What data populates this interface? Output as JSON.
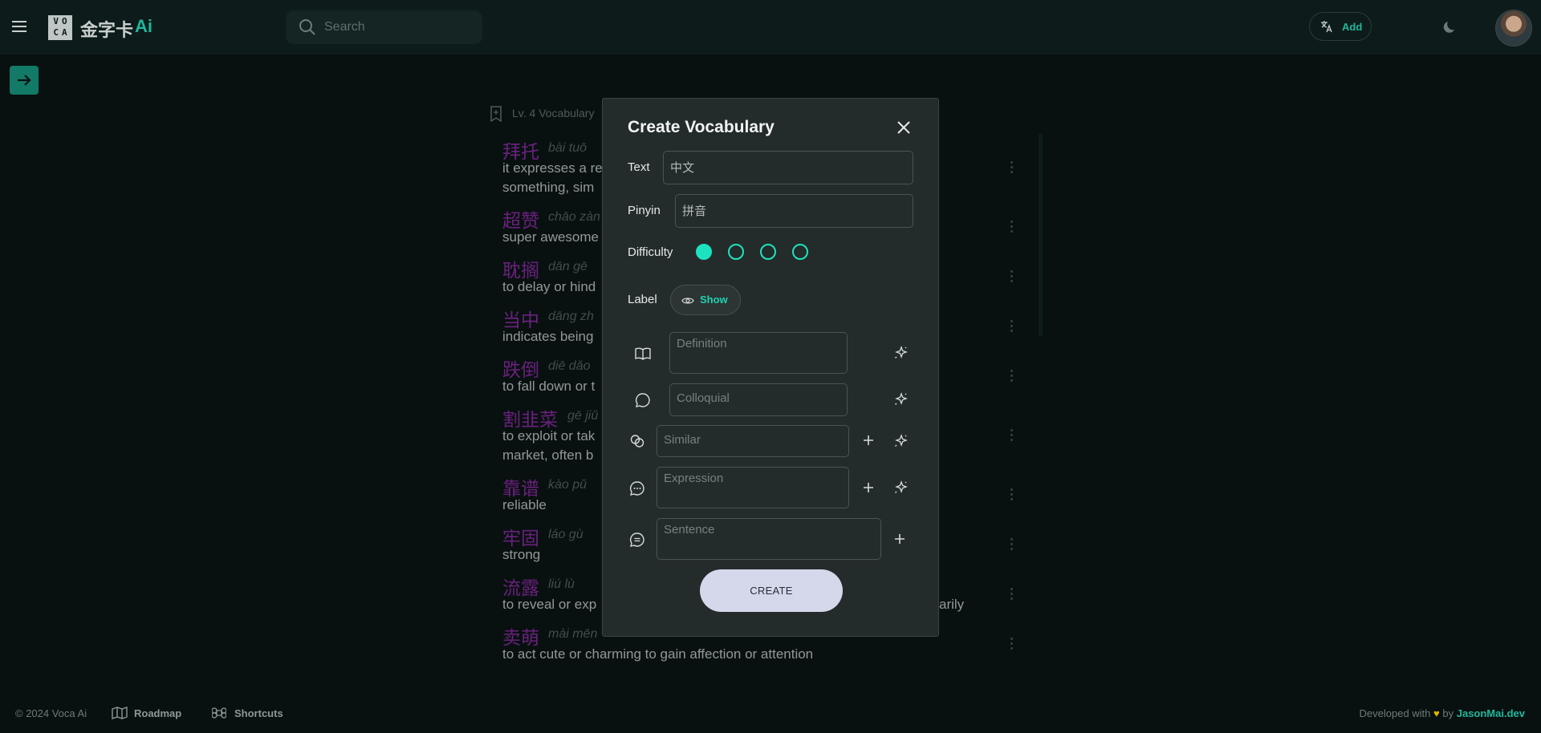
{
  "header": {
    "logo_letters_top": "VO",
    "logo_letters_bottom": "CA",
    "brand_name": "金字卡",
    "brand_ai": "Ai",
    "search_placeholder": "Search",
    "add_label": "Add"
  },
  "list": {
    "heading": "Lv. 4 Vocabulary",
    "items": [
      {
        "hanzi": "拜托",
        "pinyin": "bài tuō",
        "definition": "it expresses a re",
        "definition2": "something, sim"
      },
      {
        "hanzi": "超赞",
        "pinyin": "chāo zàn",
        "definition": "super awesome"
      },
      {
        "hanzi": "耽搁",
        "pinyin": "dān gē",
        "definition": "to delay or hind"
      },
      {
        "hanzi": "当中",
        "pinyin": "dāng zh",
        "definition": "indicates being"
      },
      {
        "hanzi": "跌倒",
        "pinyin": "diē dǎo",
        "definition": "to fall down or t"
      },
      {
        "hanzi": "割韭菜",
        "pinyin": "gē jiǔ",
        "definition": "to exploit or tak",
        "definition2": "market, often b"
      },
      {
        "hanzi": "靠谱",
        "pinyin": "kào pǔ",
        "definition": "reliable"
      },
      {
        "hanzi": "牢固",
        "pinyin": "láo gù",
        "definition": "strong"
      },
      {
        "hanzi": "流露",
        "pinyin": "liú lù",
        "definition": "to reveal or exp",
        "definition_tail": "arily"
      },
      {
        "hanzi": "卖萌",
        "pinyin": "mài mēn",
        "definition": "to act cute or charming to gain affection or attention"
      }
    ]
  },
  "modal": {
    "title": "Create Vocabulary",
    "text_label": "Text",
    "text_value": "中文",
    "pinyin_label": "Pinyin",
    "pinyin_value": "拼音",
    "difficulty_label": "Difficulty",
    "difficulty_level": 1,
    "difficulty_max": 4,
    "label_label": "Label",
    "show_label": "Show",
    "definition_placeholder": "Definition",
    "colloquial_placeholder": "Colloquial",
    "similar_placeholder": "Similar",
    "expression_placeholder": "Expression",
    "sentence_placeholder": "Sentence",
    "create_label": "CREATE"
  },
  "footer": {
    "copyright": "© 2024 Voca Ai",
    "roadmap": "Roadmap",
    "shortcuts": "Shortcuts",
    "developed_with": "Developed with",
    "heart": "♥",
    "by": "by",
    "author": "JasonMai.dev"
  },
  "colors": {
    "accent": "#1de2bf",
    "brand_green": "#22b59a",
    "hanzi_purple": "#8e2ba8",
    "background": "#0b1716"
  }
}
